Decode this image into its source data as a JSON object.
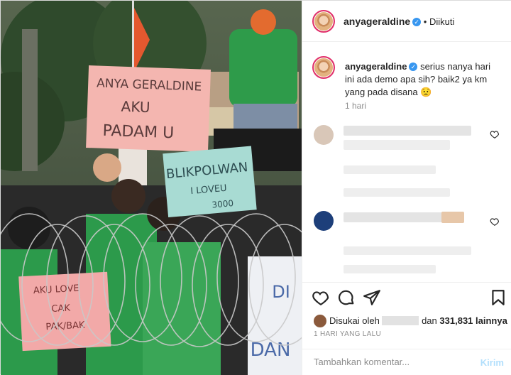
{
  "post": {
    "author": "anyageraldine",
    "follow_status": "Diikuti",
    "caption_author": "anyageraldine",
    "caption": "serius nanya hari ini ada demo apa sih? baik2 ya km yang pada disana 😟",
    "caption_time": "1 hari"
  },
  "photo": {
    "sign1": [
      "ANYA GERALDINE",
      "AKU",
      "PADAM U"
    ],
    "sign2": [
      "BLIKPOLWAN",
      "I LOVEU",
      "3000"
    ],
    "sign3": [
      "AKU LOVE",
      "CAK",
      "PAK/BAK"
    ],
    "sign4": [
      "DI",
      "DAN"
    ]
  },
  "actions": {
    "like_icon": "heart-icon",
    "comment_icon": "comment-icon",
    "share_icon": "paper-plane-icon",
    "save_icon": "bookmark-icon"
  },
  "likes": {
    "prefix": "Disukai oleh",
    "connector": "dan",
    "count": "331,831",
    "suffix": "lainnya"
  },
  "post_date": "1 HARI YANG LALU",
  "comment_box": {
    "placeholder": "Tambahkan komentar...",
    "post_label": "Kirim"
  }
}
